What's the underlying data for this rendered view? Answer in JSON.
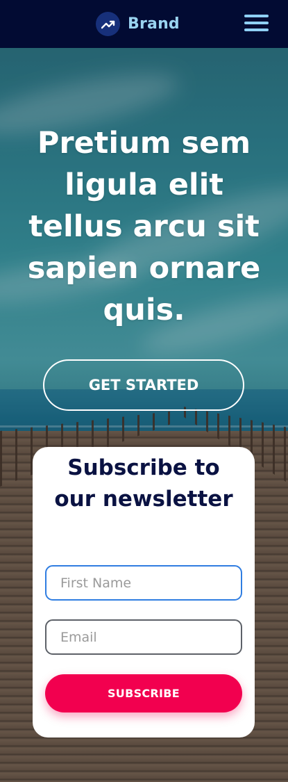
{
  "header": {
    "brand_name": "Brand",
    "brand_icon": "trending-up-icon",
    "menu_icon": "hamburger-menu-icon"
  },
  "hero": {
    "title": "Pretium sem ligula elit tellus arcu sit sapien ornare quis.",
    "cta_label": "GET STARTED"
  },
  "newsletter": {
    "title": "Subscribe to our newsletter",
    "first_name_placeholder": "First Name",
    "first_name_value": "",
    "email_placeholder": "Email",
    "email_value": "",
    "submit_label": "SUBSCRIBE"
  },
  "colors": {
    "header_bg": "#020b33",
    "brand_text": "#9ad3f0",
    "card_title": "#0a1242",
    "accent": "#f2004f",
    "focus_border": "#2f7de1"
  }
}
